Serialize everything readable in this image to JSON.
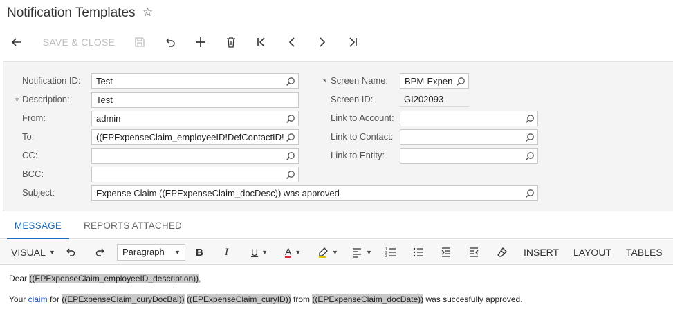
{
  "header": {
    "title": "Notification Templates",
    "favorite_icon": "star-outline-icon"
  },
  "toolbar": {
    "back_icon": "arrow-left-icon",
    "save_close_label": "SAVE & CLOSE",
    "save_icon": "floppy-disk-icon",
    "undo_icon": "undo-icon",
    "add_icon": "plus-icon",
    "delete_icon": "trash-icon",
    "first_icon": "first-page-icon",
    "prev_icon": "chevron-left-icon",
    "next_icon": "chevron-right-icon",
    "last_icon": "last-page-icon"
  },
  "form": {
    "notification_id": {
      "label": "Notification ID:",
      "value": "Test"
    },
    "description": {
      "label": "Description:",
      "value": "Test",
      "required_mark": "*"
    },
    "from": {
      "label": "From:",
      "value": "admin"
    },
    "to": {
      "label": "To:",
      "value": "((EPExpenseClaim_employeeID!DefContactID!"
    },
    "cc": {
      "label": "CC:",
      "value": ""
    },
    "bcc": {
      "label": "BCC:",
      "value": ""
    },
    "subject": {
      "label": "Subject:",
      "value": "Expense Claim ((EPExpenseClaim_docDesc)) was approved"
    },
    "screen_name": {
      "label": "Screen Name:",
      "value": "BPM-Expen",
      "required_mark": "*"
    },
    "screen_id": {
      "label": "Screen ID:",
      "value": "GI202093"
    },
    "link_account": {
      "label": "Link to Account:",
      "value": ""
    },
    "link_contact": {
      "label": "Link to Contact:",
      "value": ""
    },
    "link_entity": {
      "label": "Link to Entity:",
      "value": ""
    }
  },
  "tabs": [
    {
      "label": "MESSAGE",
      "active": true
    },
    {
      "label": "REPORTS ATTACHED",
      "active": false
    }
  ],
  "editor_toolbar": {
    "visual_label": "VISUAL",
    "paragraph_value": "Paragraph",
    "bold_label": "B",
    "italic_label": "I",
    "underline_label": "U",
    "font_color_label": "A",
    "insert_label": "INSERT",
    "layout_label": "LAYOUT",
    "tables_label": "TABLES"
  },
  "message": {
    "line1_prefix": "Dear ",
    "line1_field": "((EPExpenseClaim_employeeID_description))",
    "line1_suffix": ",",
    "line2_prefix": "Your ",
    "line2_link": "claim",
    "line2_for": " for ",
    "line2_field1": "((EPExpenseClaim_curyDocBal))",
    "line2_field2": "((EPExpenseClaim_curyID))",
    "line2_from": " from ",
    "line2_field3": "((EPExpenseClaim_docDate))",
    "line2_suffix": " was succesfully approved."
  }
}
